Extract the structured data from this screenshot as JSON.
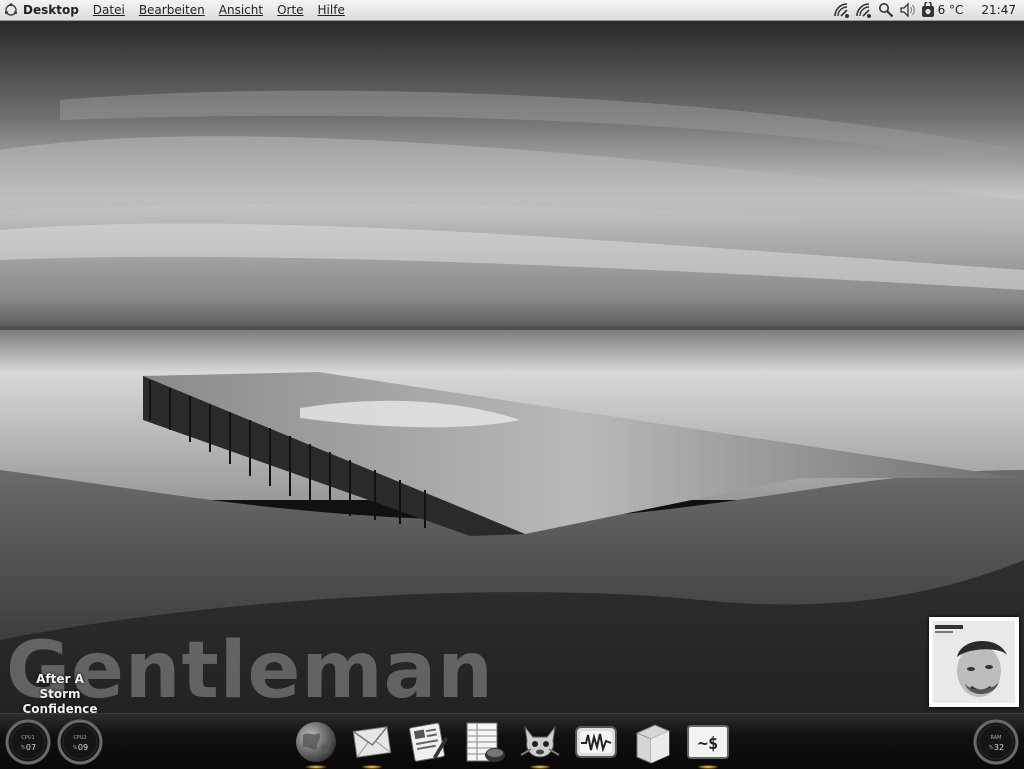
{
  "top_panel": {
    "menus": [
      {
        "label": "Desktop",
        "bold": true
      },
      {
        "label": "Datei"
      },
      {
        "label": "Bearbeiten"
      },
      {
        "label": "Ansicht"
      },
      {
        "label": "Orte"
      },
      {
        "label": "Hilfe"
      }
    ],
    "tray": {
      "icons": [
        "network-icon",
        "network-icon",
        "search-icon",
        "volume-icon",
        "weather-icon"
      ],
      "temperature": "6 °C",
      "clock": "21:47"
    }
  },
  "desktop": {
    "watermark": "Gentleman",
    "now_playing": {
      "title": "After A Storm",
      "album": "Confidence"
    },
    "album_art": {
      "lettering": "Gentleman Confidence"
    }
  },
  "bottom_panel": {
    "gauges_left": [
      {
        "label": "CPU1",
        "value": "07",
        "unit": "%",
        "percent": 7
      },
      {
        "label": "CPU2",
        "value": "09",
        "unit": "%",
        "percent": 9
      }
    ],
    "gauge_right": {
      "label": "RAM",
      "value": "32",
      "unit": "%",
      "percent": 32
    },
    "dock": [
      {
        "icon": "globe-icon",
        "running": true
      },
      {
        "icon": "mail-icon",
        "running": true
      },
      {
        "icon": "editor-icon",
        "running": false
      },
      {
        "icon": "spreadsheet-icon",
        "running": false
      },
      {
        "icon": "gimp-icon",
        "running": true
      },
      {
        "icon": "system-monitor-icon",
        "running": false
      },
      {
        "icon": "box-icon",
        "running": false
      },
      {
        "icon": "terminal-icon",
        "running": true
      }
    ],
    "terminal_glyph": "~$"
  },
  "colors": {
    "panel_top": "#f4f4f4",
    "panel_bottom": "#080808",
    "running_indicator": "#ffd54a"
  }
}
